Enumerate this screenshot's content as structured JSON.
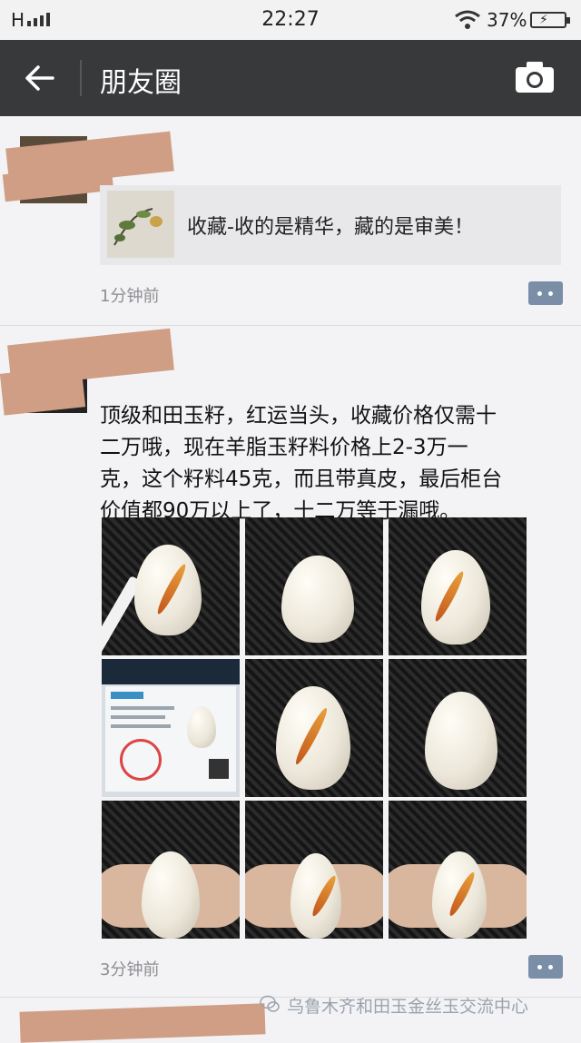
{
  "status_bar": {
    "signal": "H",
    "time": "22:27",
    "battery": "37%"
  },
  "header": {
    "title": "朋友圈",
    "back_icon": "back-arrow-icon",
    "camera_icon": "camera-icon"
  },
  "posts": [
    {
      "shared_link": {
        "text": "收藏-收的是精华，藏的是审美！"
      },
      "time": "1分钟前"
    },
    {
      "text_lines": [
        "顶级和田玉籽，红运当头，收藏价格仅需十",
        "二万哦，现在羊脂玉籽料价格上2-3万一",
        "克，这个籽料45克，而且带真皮，最后柜台",
        "价值都90万以上了，十二万等于漏哦。"
      ],
      "photo_count": 9,
      "time": "3分钟前"
    }
  ],
  "watermark": {
    "text": "乌鲁木齐和田玉金丝玉交流中心"
  },
  "colors": {
    "navbar": "#37393b",
    "feed_bg": "#f3f3f5",
    "comment_button": "#7b8ea8"
  }
}
